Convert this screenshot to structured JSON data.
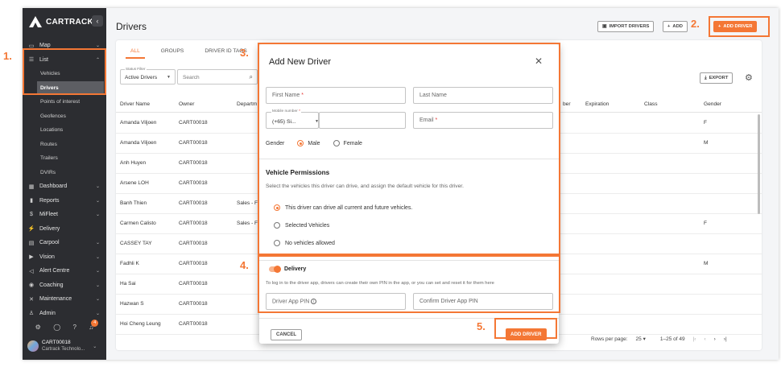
{
  "app": {
    "brand": "CARTRACK",
    "collapse_icon": "chevron-left-icon"
  },
  "sidebar": {
    "items": [
      {
        "label": "Map",
        "icon": "map-icon",
        "glyph": "▭",
        "chevron": "⌄"
      },
      {
        "label": "List",
        "icon": "list-icon",
        "glyph": "☰",
        "chevron": "⌃"
      },
      {
        "label": "Vehicles",
        "sub": true
      },
      {
        "label": "Drivers",
        "sub": true,
        "active": true
      },
      {
        "label": "Points of interest",
        "sub": true
      },
      {
        "label": "Geofences",
        "sub": true
      },
      {
        "label": "Locations",
        "sub": true
      },
      {
        "label": "Routes",
        "sub": true
      },
      {
        "label": "Trailers",
        "sub": true
      },
      {
        "label": "DVIRs",
        "sub": true
      },
      {
        "label": "Dashboard",
        "icon": "dashboard-icon",
        "glyph": "▦",
        "chevron": "⌄"
      },
      {
        "label": "Reports",
        "icon": "bar-chart-icon",
        "glyph": "▮",
        "chevron": "⌄"
      },
      {
        "label": "MiFleet",
        "icon": "dollar-icon",
        "glyph": "$",
        "chevron": "⌄"
      },
      {
        "label": "Delivery",
        "icon": "bolt-icon",
        "glyph": "⚡",
        "chevron": ""
      },
      {
        "label": "Carpool",
        "icon": "calendar-icon",
        "glyph": "▤",
        "chevron": "⌄"
      },
      {
        "label": "Vision",
        "icon": "video-icon",
        "glyph": "▶",
        "chevron": "⌄"
      },
      {
        "label": "Alert Centre",
        "icon": "megaphone-icon",
        "glyph": "◁",
        "chevron": "⌄"
      },
      {
        "label": "Coaching",
        "icon": "coaching-icon",
        "glyph": "◉",
        "chevron": "⌄"
      },
      {
        "label": "Maintenance",
        "icon": "wrench-icon",
        "glyph": "✕",
        "chevron": "⌄"
      },
      {
        "label": "Admin",
        "icon": "admin-icon",
        "glyph": "♙",
        "chevron": "⌄"
      }
    ],
    "bottom_icons": [
      {
        "name": "settings-icon",
        "glyph": "⚙"
      },
      {
        "name": "shield-icon",
        "glyph": "◯"
      },
      {
        "name": "help-icon",
        "glyph": "?"
      },
      {
        "name": "bell-icon",
        "glyph": "♫"
      }
    ],
    "notification_count": "4",
    "user": {
      "name": "CART00018",
      "company": "Cartrack Technolo..."
    }
  },
  "header": {
    "title": "Drivers",
    "import_label": "IMPORT DRIVERS",
    "add_label": "ADD",
    "add_driver_label": "ADD DRIVER"
  },
  "tabs": [
    {
      "label": "ALL",
      "active": true
    },
    {
      "label": "GROUPS"
    },
    {
      "label": "DRIVER ID TAGS"
    }
  ],
  "filters": {
    "status_label": "Status Filter",
    "status_value": "Active Drivers",
    "search_placeholder": "Search",
    "export_label": "EXPORT"
  },
  "table": {
    "columns": [
      "Driver Name",
      "Owner",
      "Departm",
      "ber",
      "Expiration",
      "Class",
      "Gender"
    ],
    "rows": [
      {
        "name": "Amanda Viljoen",
        "owner": "CART00018",
        "dept": "",
        "gender": "F"
      },
      {
        "name": "Amanda Viljoen",
        "owner": "CART00018",
        "dept": "",
        "gender": "M"
      },
      {
        "name": "Anh Huyen",
        "owner": "CART00018",
        "dept": "",
        "gender": ""
      },
      {
        "name": "Arsene LOH",
        "owner": "CART00018",
        "dept": "",
        "gender": ""
      },
      {
        "name": "Banh Thien",
        "owner": "CART00018",
        "dept": "Sales - F",
        "gender": ""
      },
      {
        "name": "Carmen Calisto",
        "owner": "CART00018",
        "dept": "Sales - F",
        "gender": "F"
      },
      {
        "name": "CASSEY TAY",
        "owner": "CART00018",
        "dept": "",
        "gender": ""
      },
      {
        "name": "Fadhli K",
        "owner": "CART00018",
        "dept": "",
        "gender": "M"
      },
      {
        "name": "Ha Sai",
        "owner": "CART00018",
        "dept": "",
        "gender": ""
      },
      {
        "name": "Hazwan S",
        "owner": "CART00018",
        "dept": "",
        "gender": ""
      },
      {
        "name": "Hoi Cheng Leung",
        "owner": "CART00018",
        "dept": "",
        "gender": ""
      }
    ]
  },
  "pagination": {
    "rows_per_page_label": "Rows per page:",
    "rows_per_page": "25",
    "range": "1–25 of 49"
  },
  "modal": {
    "title": "Add New Driver",
    "first_name": "First Name",
    "last_name": "Last Name",
    "mobile_label": "Mobile number",
    "mobile_code": "(+65) Si...",
    "email": "Email",
    "gender_label": "Gender",
    "gender_options": [
      "Male",
      "Female"
    ],
    "gender_selected": "Male",
    "permissions_title": "Vehicle Permissions",
    "permissions_desc": "Select the vehicles this driver can drive, and assign the default vehicle for this driver.",
    "permission_options": [
      "This driver can drive all current and future vehicles.",
      "Selected Vehicles",
      "No vehicles allowed"
    ],
    "delivery_label": "Delivery",
    "delivery_enabled": true,
    "delivery_desc": "To log in to the driver app, drivers can create their own PIN in the app, or you can set and reset it for them here",
    "pin_placeholder": "Driver App PIN",
    "confirm_pin_placeholder": "Confirm Driver App PIN",
    "cancel_label": "CANCEL",
    "submit_label": "ADD DRIVER"
  },
  "annotations": [
    "1.",
    "2.",
    "3.",
    "4.",
    "5."
  ],
  "colors": {
    "accent": "#f47735",
    "sidebar": "#2c2d31"
  }
}
